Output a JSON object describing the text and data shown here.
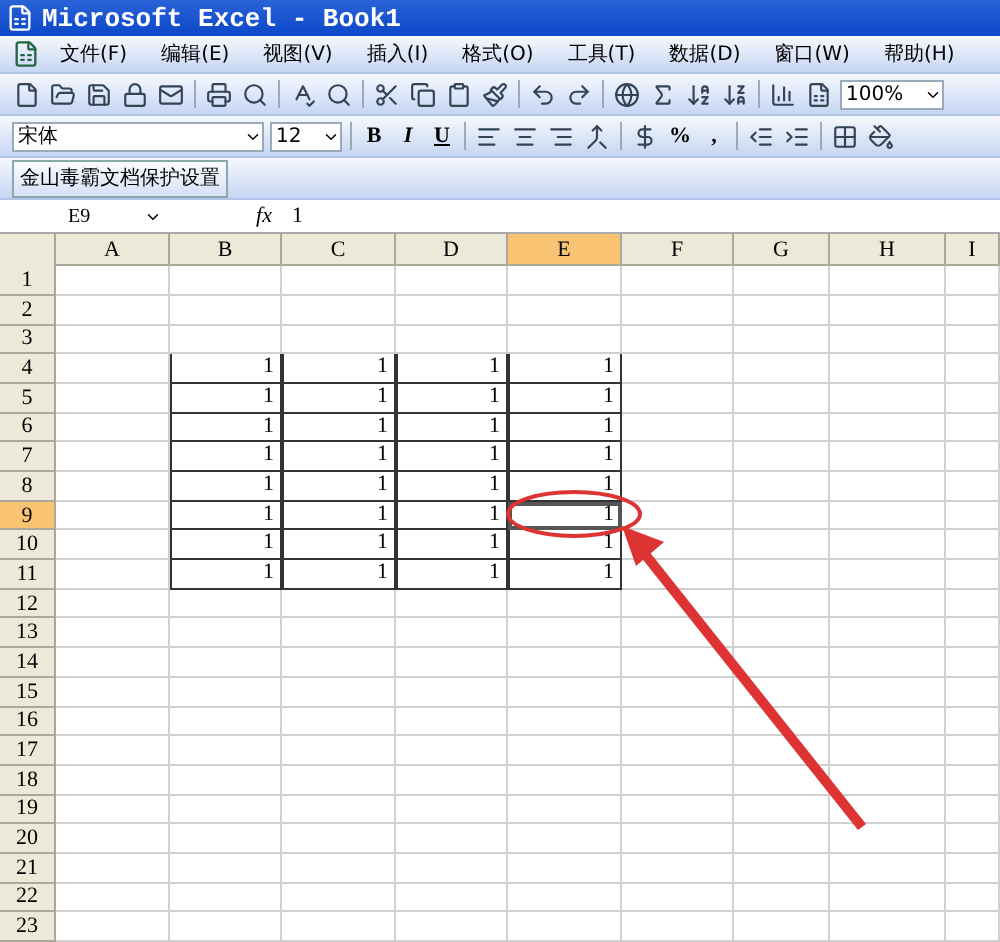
{
  "window": {
    "title": "Microsoft Excel - Book1"
  },
  "menu": [
    "文件(F)",
    "编辑(E)",
    "视图(V)",
    "插入(I)",
    "格式(O)",
    "工具(T)",
    "数据(D)",
    "窗口(W)",
    "帮助(H)"
  ],
  "standard_toolbar": {
    "zoom": "100%"
  },
  "format_toolbar": {
    "font": "宋体",
    "size": "12",
    "style_buttons": [
      "B",
      "I",
      "U"
    ],
    "percent": "%",
    "comma": ","
  },
  "addin_toolbar": {
    "button": "金山毒霸文档保护设置"
  },
  "formula_bar": {
    "name_box": "E9",
    "fx": "fx",
    "value": "1"
  },
  "columns": [
    {
      "label": "A",
      "selected": false
    },
    {
      "label": "B",
      "selected": false
    },
    {
      "label": "C",
      "selected": false
    },
    {
      "label": "D",
      "selected": false
    },
    {
      "label": "E",
      "selected": true
    },
    {
      "label": "F",
      "selected": false
    },
    {
      "label": "G",
      "selected": false
    },
    {
      "label": "H",
      "selected": false
    },
    {
      "label": "I",
      "selected": false
    }
  ],
  "rows": [
    {
      "label": "1",
      "selected": false
    },
    {
      "label": "2",
      "selected": false
    },
    {
      "label": "3",
      "selected": false
    },
    {
      "label": "4",
      "selected": false,
      "cells": [
        "1",
        "1",
        "1",
        "1"
      ]
    },
    {
      "label": "5",
      "selected": false,
      "cells": [
        "1",
        "1",
        "1",
        "1"
      ]
    },
    {
      "label": "6",
      "selected": false,
      "cells": [
        "1",
        "1",
        "1",
        "1"
      ]
    },
    {
      "label": "7",
      "selected": false,
      "cells": [
        "1",
        "1",
        "1",
        "1"
      ]
    },
    {
      "label": "8",
      "selected": false,
      "cells": [
        "1",
        "1",
        "1",
        "1"
      ]
    },
    {
      "label": "9",
      "selected": true,
      "cells": [
        "1",
        "1",
        "1",
        "1"
      ]
    },
    {
      "label": "10",
      "selected": false,
      "cells": [
        "1",
        "1",
        "1",
        "1"
      ]
    },
    {
      "label": "11",
      "selected": false,
      "cells": [
        "1",
        "1",
        "1",
        "1"
      ]
    },
    {
      "label": "12",
      "selected": false
    },
    {
      "label": "13",
      "selected": false
    },
    {
      "label": "14",
      "selected": false
    },
    {
      "label": "15",
      "selected": false
    },
    {
      "label": "16",
      "selected": false
    },
    {
      "label": "17",
      "selected": false
    },
    {
      "label": "18",
      "selected": false
    },
    {
      "label": "19",
      "selected": false
    },
    {
      "label": "20",
      "selected": false
    },
    {
      "label": "21",
      "selected": false
    },
    {
      "label": "22",
      "selected": false
    },
    {
      "label": "23",
      "selected": false
    }
  ]
}
